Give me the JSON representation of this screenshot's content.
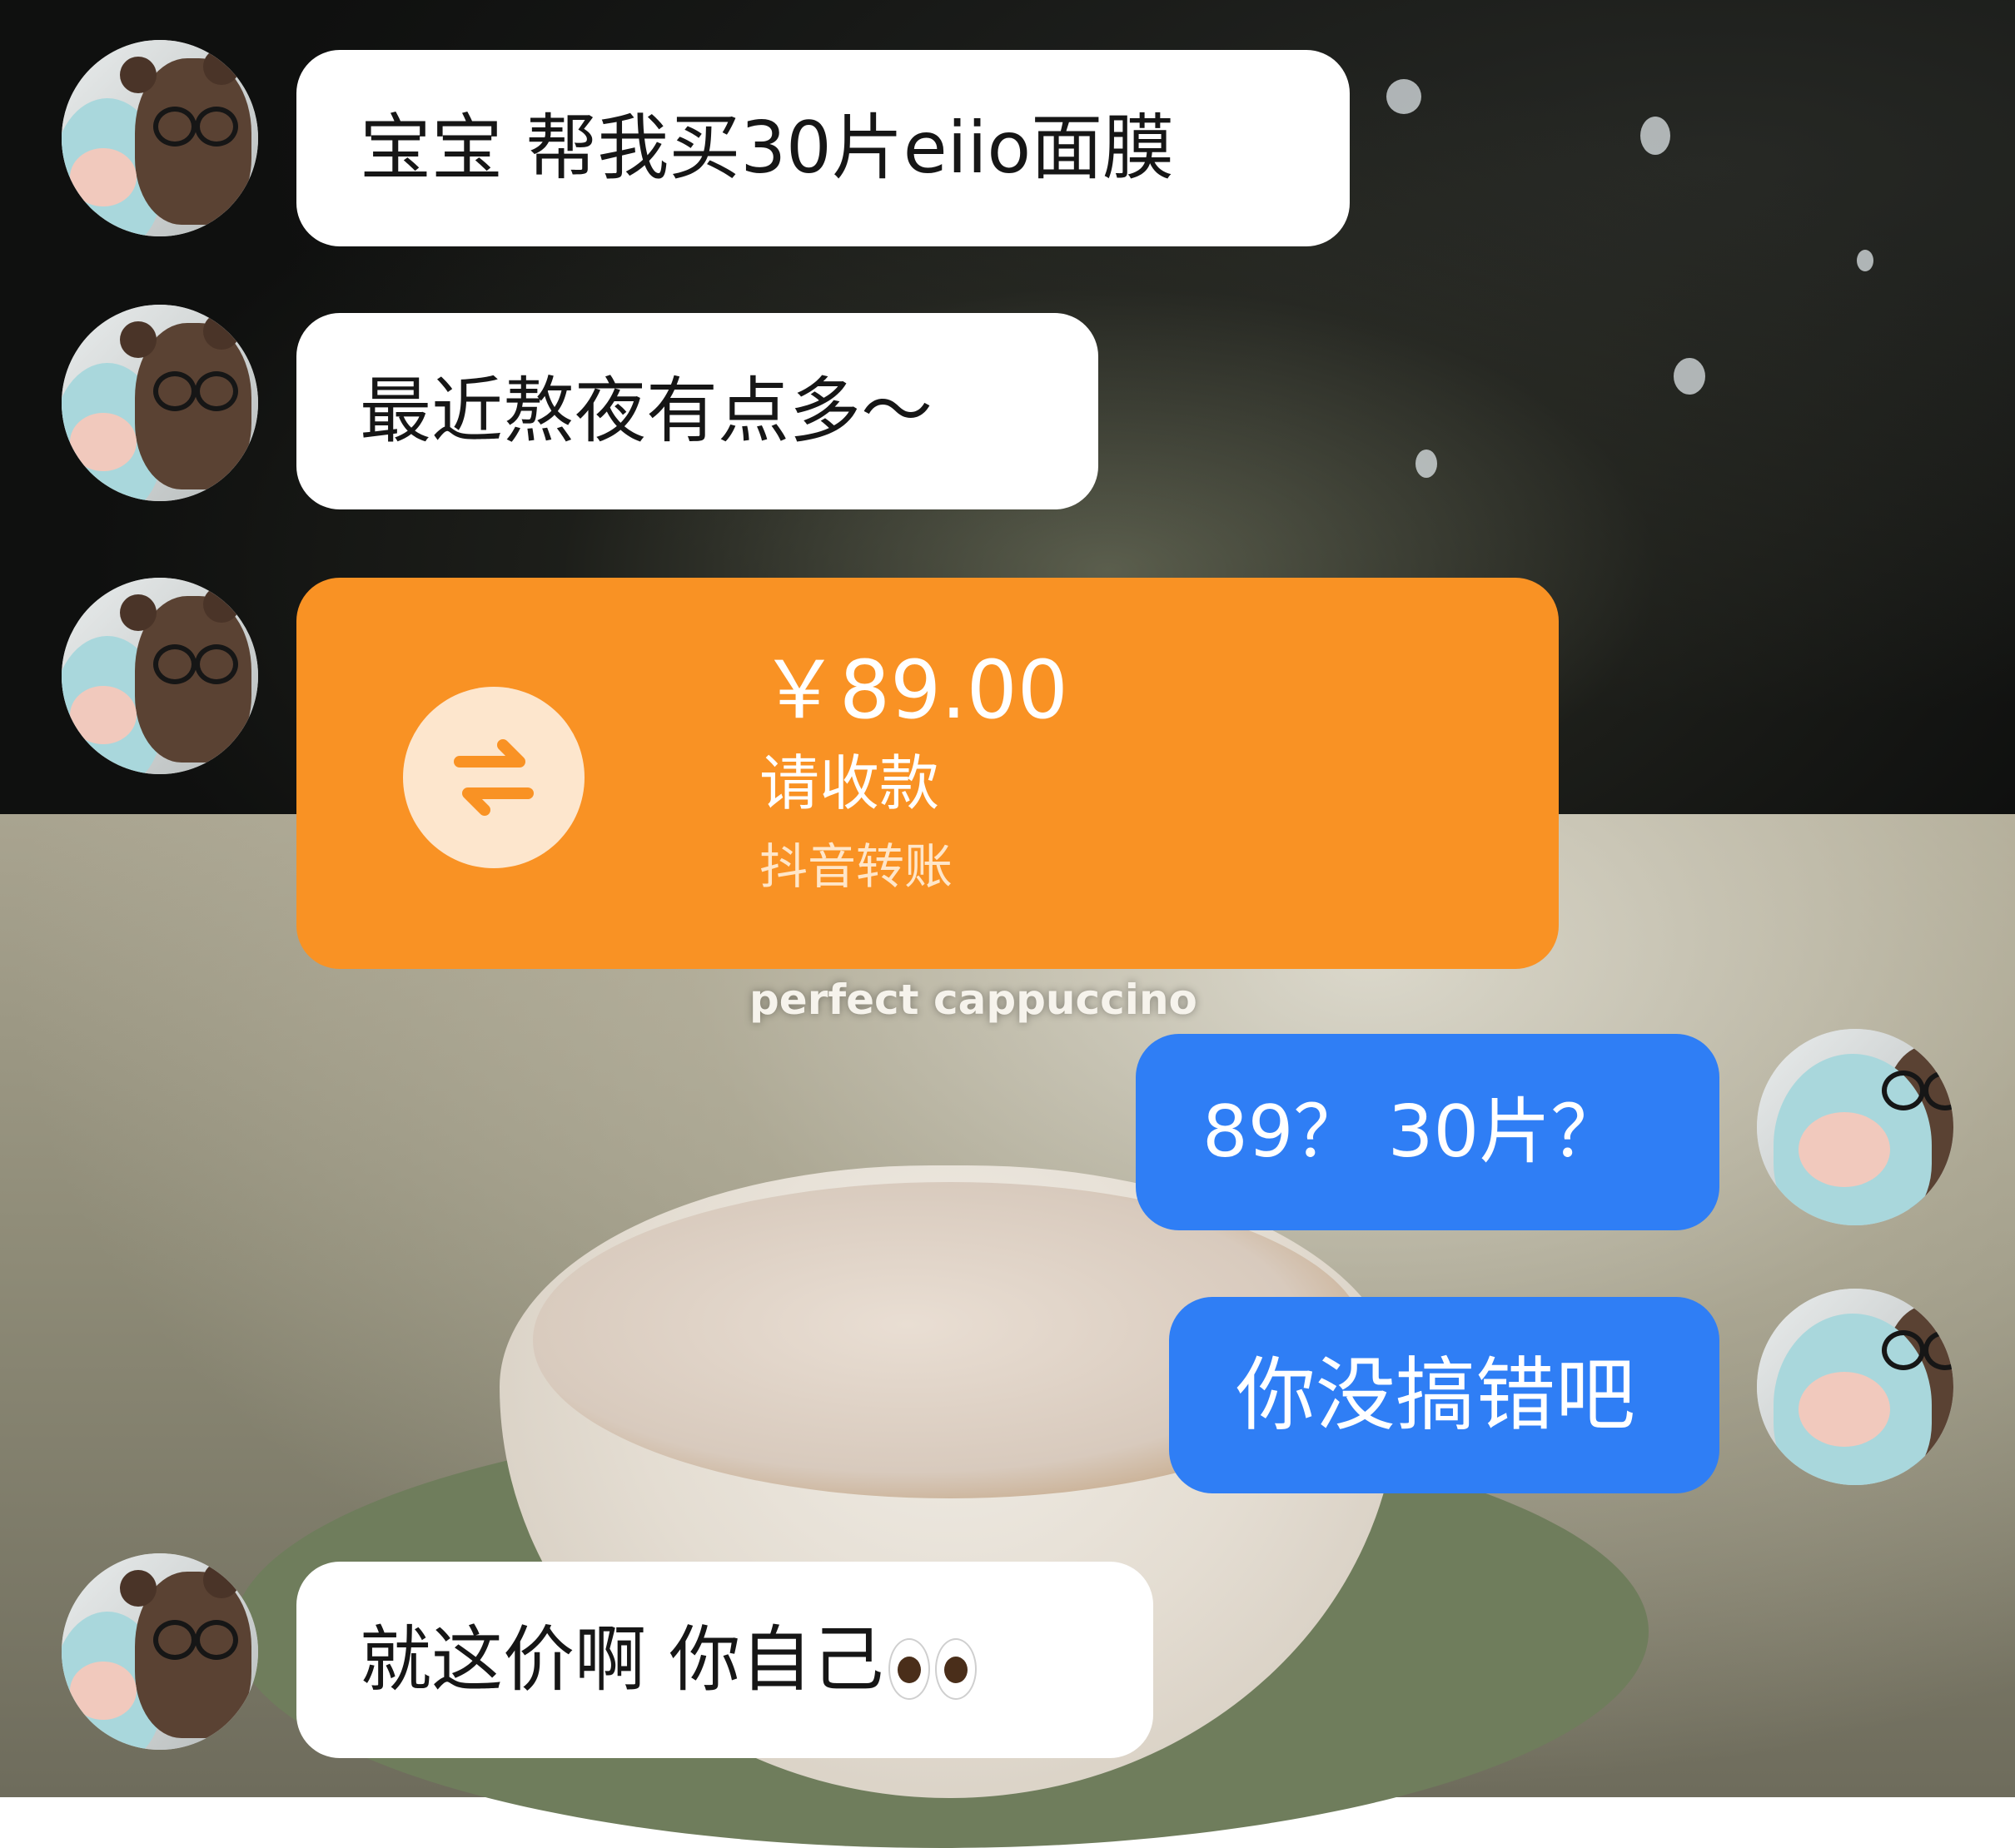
{
  "background": {
    "caption": "perfect cappuccino"
  },
  "messages": [
    {
      "side": "left",
      "type": "text",
      "text": "宝宝 帮我买30片eiio面膜"
    },
    {
      "side": "left",
      "type": "text",
      "text": "最近熬夜有点多～"
    },
    {
      "side": "left",
      "type": "transfer",
      "amount": "￥89.00",
      "status": "请收款",
      "label": "抖音转账",
      "icon": "transfer-arrows-icon"
    },
    {
      "side": "right",
      "type": "text",
      "text": "89？ 30片？"
    },
    {
      "side": "right",
      "type": "text",
      "text": "你没搞错吧"
    },
    {
      "side": "left",
      "type": "text",
      "text": "就这价啊 你自己",
      "emoji": "eyes-emoji"
    }
  ],
  "colors": {
    "left_bubble": "#ffffff",
    "right_bubble": "#2f7ef5",
    "transfer_card": "#f99224",
    "transfer_icon_bg": "#fde6cd"
  }
}
